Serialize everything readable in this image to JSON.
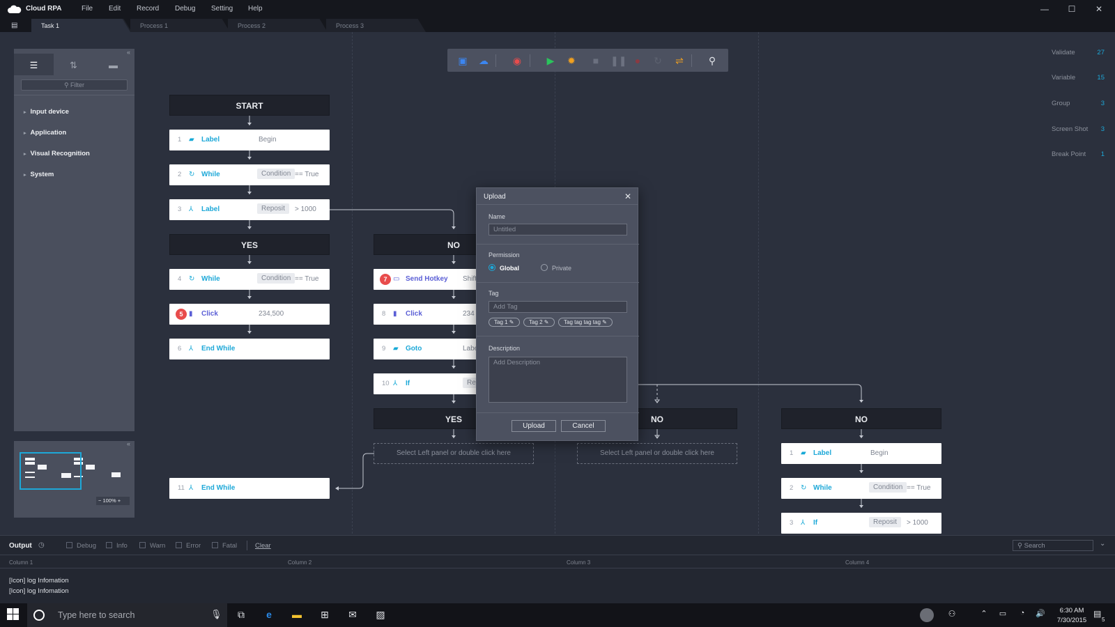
{
  "app": {
    "name": "Cloud RPA",
    "menu": [
      "File",
      "Edit",
      "Record",
      "Debug",
      "Setting",
      "Help"
    ]
  },
  "tabs": [
    "Task 1",
    "Process 1",
    "Process 2",
    "Process 3"
  ],
  "left_panel": {
    "filter_placeholder": "Filter",
    "tree": [
      "Input device",
      "Application",
      "Visual Recognition",
      "System"
    ],
    "zoom": "100%"
  },
  "stats": [
    {
      "label": "Validate",
      "value": "27"
    },
    {
      "label": "Variable",
      "value": "15"
    },
    {
      "label": "Group",
      "value": "3"
    },
    {
      "label": "Screen Shot",
      "value": "3"
    },
    {
      "label": "Break Point",
      "value": "1"
    }
  ],
  "flow": {
    "start": "START",
    "yes": "YES",
    "no": "NO",
    "nodes_left": [
      {
        "num": "1",
        "label": "Label",
        "value": "Begin"
      },
      {
        "num": "2",
        "label": "While",
        "chip": "Condition",
        "rest": "== True"
      },
      {
        "num": "3",
        "label": "Label",
        "chip": "Reposit",
        "rest": "> 1000"
      },
      {
        "num": "4",
        "label": "While",
        "chip": "Condition",
        "rest": "== True"
      },
      {
        "num": "5",
        "label": "Click",
        "value": "234,500"
      },
      {
        "num": "6",
        "label": "End While"
      },
      {
        "num": "11",
        "label": "End While"
      }
    ],
    "nodes_mid": [
      {
        "num": "7",
        "label": "Send Hotkey",
        "value": "Shift"
      },
      {
        "num": "8",
        "label": "Click",
        "value": "234"
      },
      {
        "num": "9",
        "label": "Goto",
        "value": "Labe"
      },
      {
        "num": "10",
        "label": "If",
        "value": "Re"
      }
    ],
    "placeholder": "Select Left panel or double click here",
    "nodes_right": [
      {
        "num": "1",
        "label": "Label",
        "value": "Begin"
      },
      {
        "num": "2",
        "label": "While",
        "chip": "Condition",
        "rest": "== True"
      },
      {
        "num": "3",
        "label": "If",
        "chip": "Reposit",
        "rest": "> 1000"
      }
    ]
  },
  "dialog": {
    "title": "Upload",
    "name_label": "Name",
    "name_placeholder": "Untitled",
    "permission_label": "Permission",
    "perm_global": "Global",
    "perm_private": "Private",
    "tag_label": "Tag",
    "tag_placeholder": "Add Tag",
    "tags": [
      "Tag 1",
      "Tag 2",
      "Tag tag tag tag"
    ],
    "desc_label": "Description",
    "desc_placeholder": "Add Description",
    "upload": "Upload",
    "cancel": "Cancel"
  },
  "output": {
    "title": "Output",
    "levels": [
      "Debug",
      "Info",
      "Warn",
      "Error",
      "Fatal"
    ],
    "clear": "Clear",
    "search_placeholder": "Search",
    "columns": [
      "Column 1",
      "Column 2",
      "Column 3",
      "Column 4"
    ],
    "logs": [
      "[Icon] log Infomation",
      "[Icon] log Infomation"
    ]
  },
  "taskbar": {
    "search_placeholder": "Type here to search",
    "time": "6:30 AM",
    "date": "7/30/2015",
    "notif_count": "5"
  },
  "colors": {
    "accent": "#1da8d8",
    "breakpoint": "#e84c4c",
    "bg": "#2b303d"
  }
}
